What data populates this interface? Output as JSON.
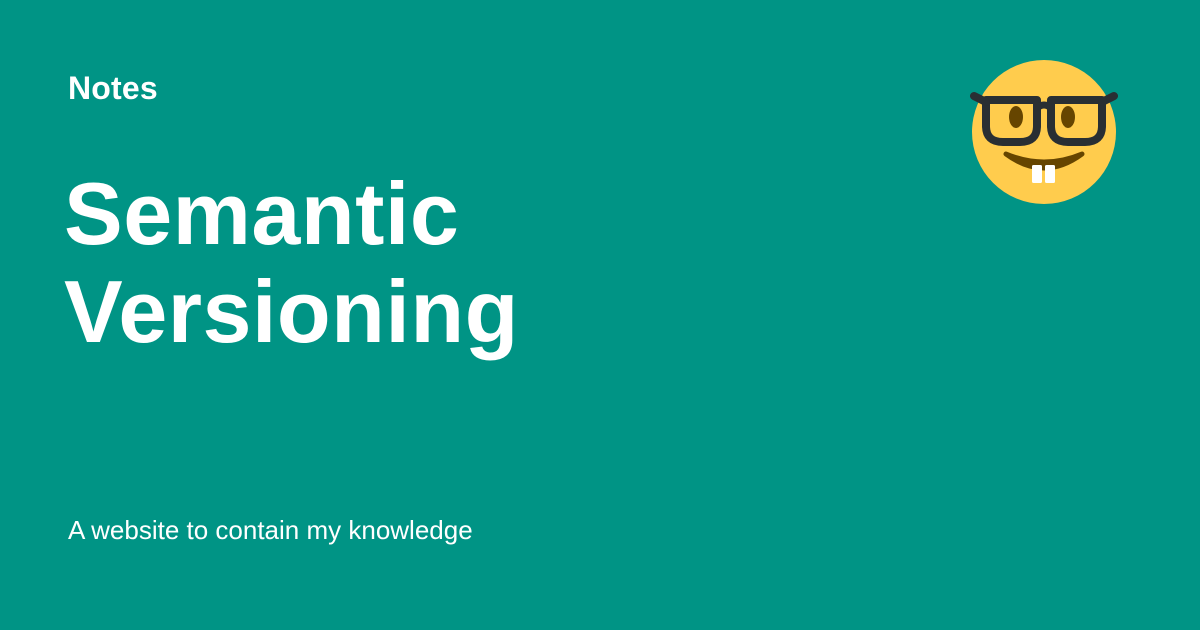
{
  "site": {
    "name": "Notes"
  },
  "page": {
    "title_line_1": "Semantic",
    "title_line_2": "Versioning"
  },
  "tagline": "A website to contain my knowledge",
  "logo": {
    "icon": "nerd-face-icon"
  },
  "colors": {
    "background": "#009485",
    "text": "#ffffff",
    "face": "#FFCC4D",
    "glasses": "#292F33",
    "eyes": "#664500"
  }
}
